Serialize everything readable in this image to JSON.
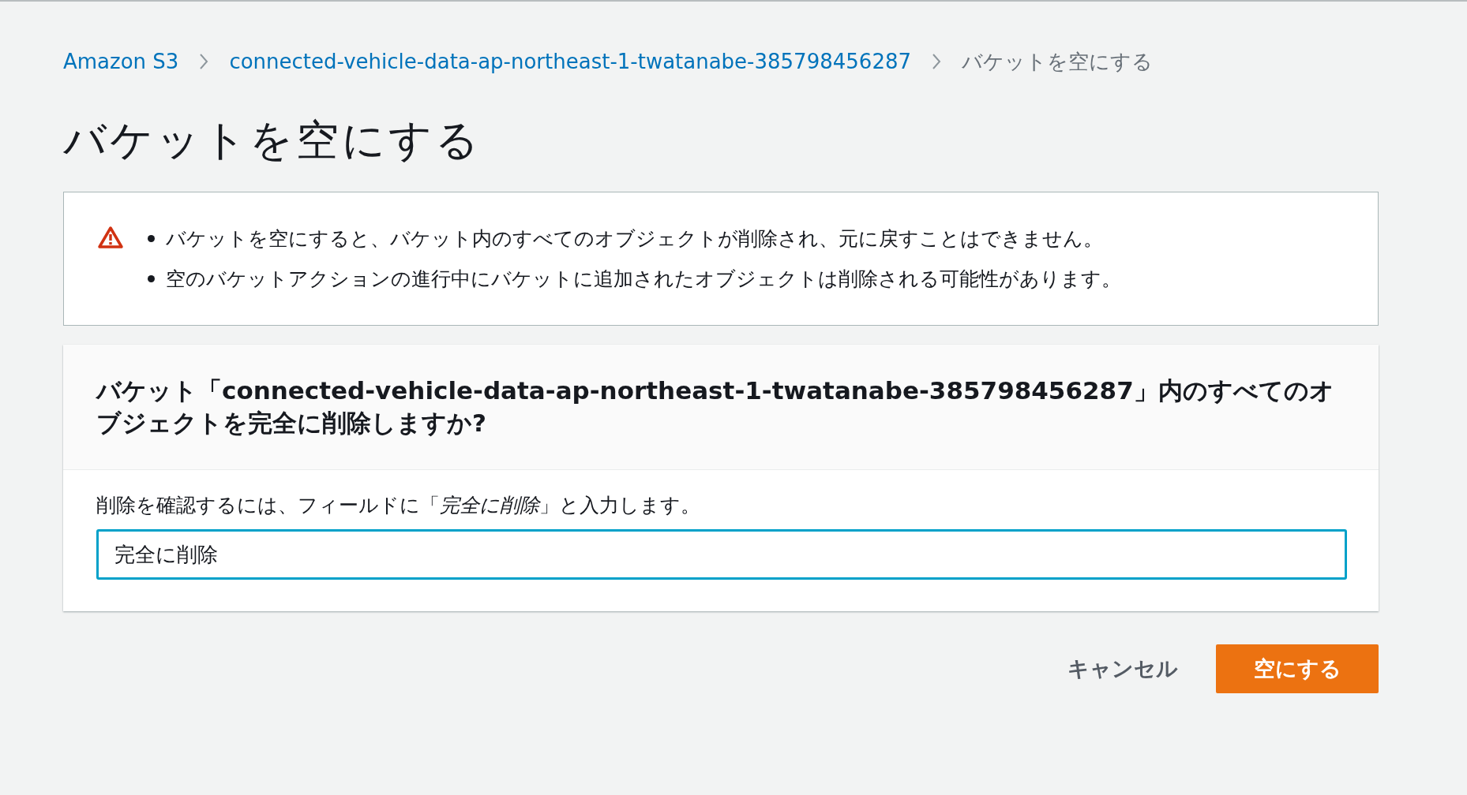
{
  "breadcrumb": [
    {
      "label": "Amazon S3",
      "kind": "link"
    },
    {
      "label": "connected-vehicle-data-ap-northeast-1-twatanabe-385798456287",
      "kind": "link"
    },
    {
      "label": "バケットを空にする",
      "kind": "current"
    }
  ],
  "page_title": "バケットを空にする",
  "warning": {
    "items": [
      "バケットを空にすると、バケット内のすべてのオブジェクトが削除され、元に戻すことはできません。",
      "空のバケットアクションの進行中にバケットに追加されたオブジェクトは削除される可能性があります。"
    ]
  },
  "confirm_panel": {
    "heading": "バケット「connected-vehicle-data-ap-northeast-1-twatanabe-385798456287」内のすべてのオブジェクトを完全に削除しますか?",
    "instruction": "削除を確認するには、フィールドに「*完全に削除*」と入力します。",
    "field": {
      "value": "完全に削除",
      "focused": true
    }
  },
  "buttons": [
    {
      "label": "キャンセル",
      "kind": "link"
    },
    {
      "label": "空にする",
      "kind": "primary"
    }
  ]
}
